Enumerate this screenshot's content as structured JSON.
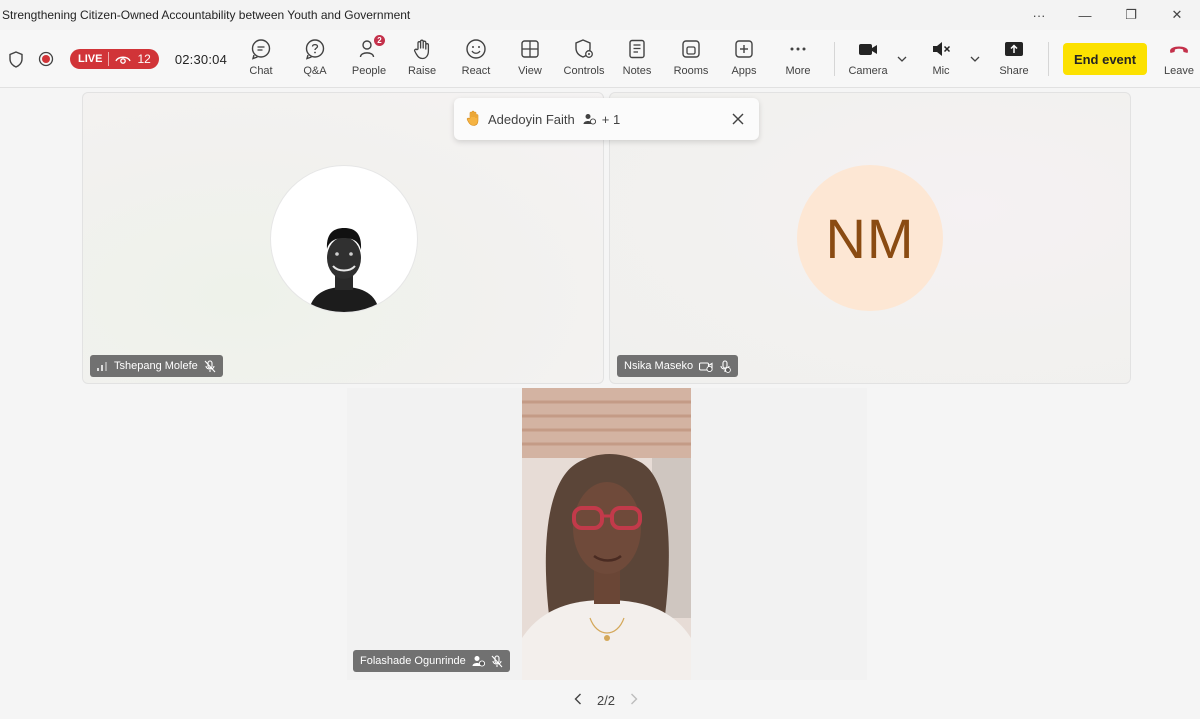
{
  "window": {
    "title": "Strengthening Citizen-Owned Accountability between Youth and Government",
    "more_glyph": "···",
    "minimize_glyph": "—",
    "restore_glyph": "❐",
    "close_glyph": "✕"
  },
  "toolbar": {
    "live_label": "LIVE",
    "viewer_count": "12",
    "timer": "02:30:04",
    "buttons": {
      "chat": "Chat",
      "qa": "Q&A",
      "people": "People",
      "people_badge": "2",
      "raise": "Raise",
      "react": "React",
      "view": "View",
      "controls": "Controls",
      "notes": "Notes",
      "rooms": "Rooms",
      "apps": "Apps",
      "more": "More",
      "camera": "Camera",
      "mic": "Mic",
      "share": "Share",
      "end_event": "End event",
      "leave": "Leave"
    },
    "colors": {
      "live": "#d13438",
      "end_event": "#fce100",
      "leave": "#c4314b"
    }
  },
  "raise_notification": {
    "name": "Adedoyin Faith",
    "extra": "+ 1"
  },
  "participants": [
    {
      "name": "Tshepang Molefe",
      "avatar": "photo"
    },
    {
      "name": "Nsika Maseko",
      "initials": "NM"
    },
    {
      "name": "Folashade Ogunrinde",
      "avatar": "video"
    }
  ],
  "pager": {
    "label": "2/2"
  }
}
